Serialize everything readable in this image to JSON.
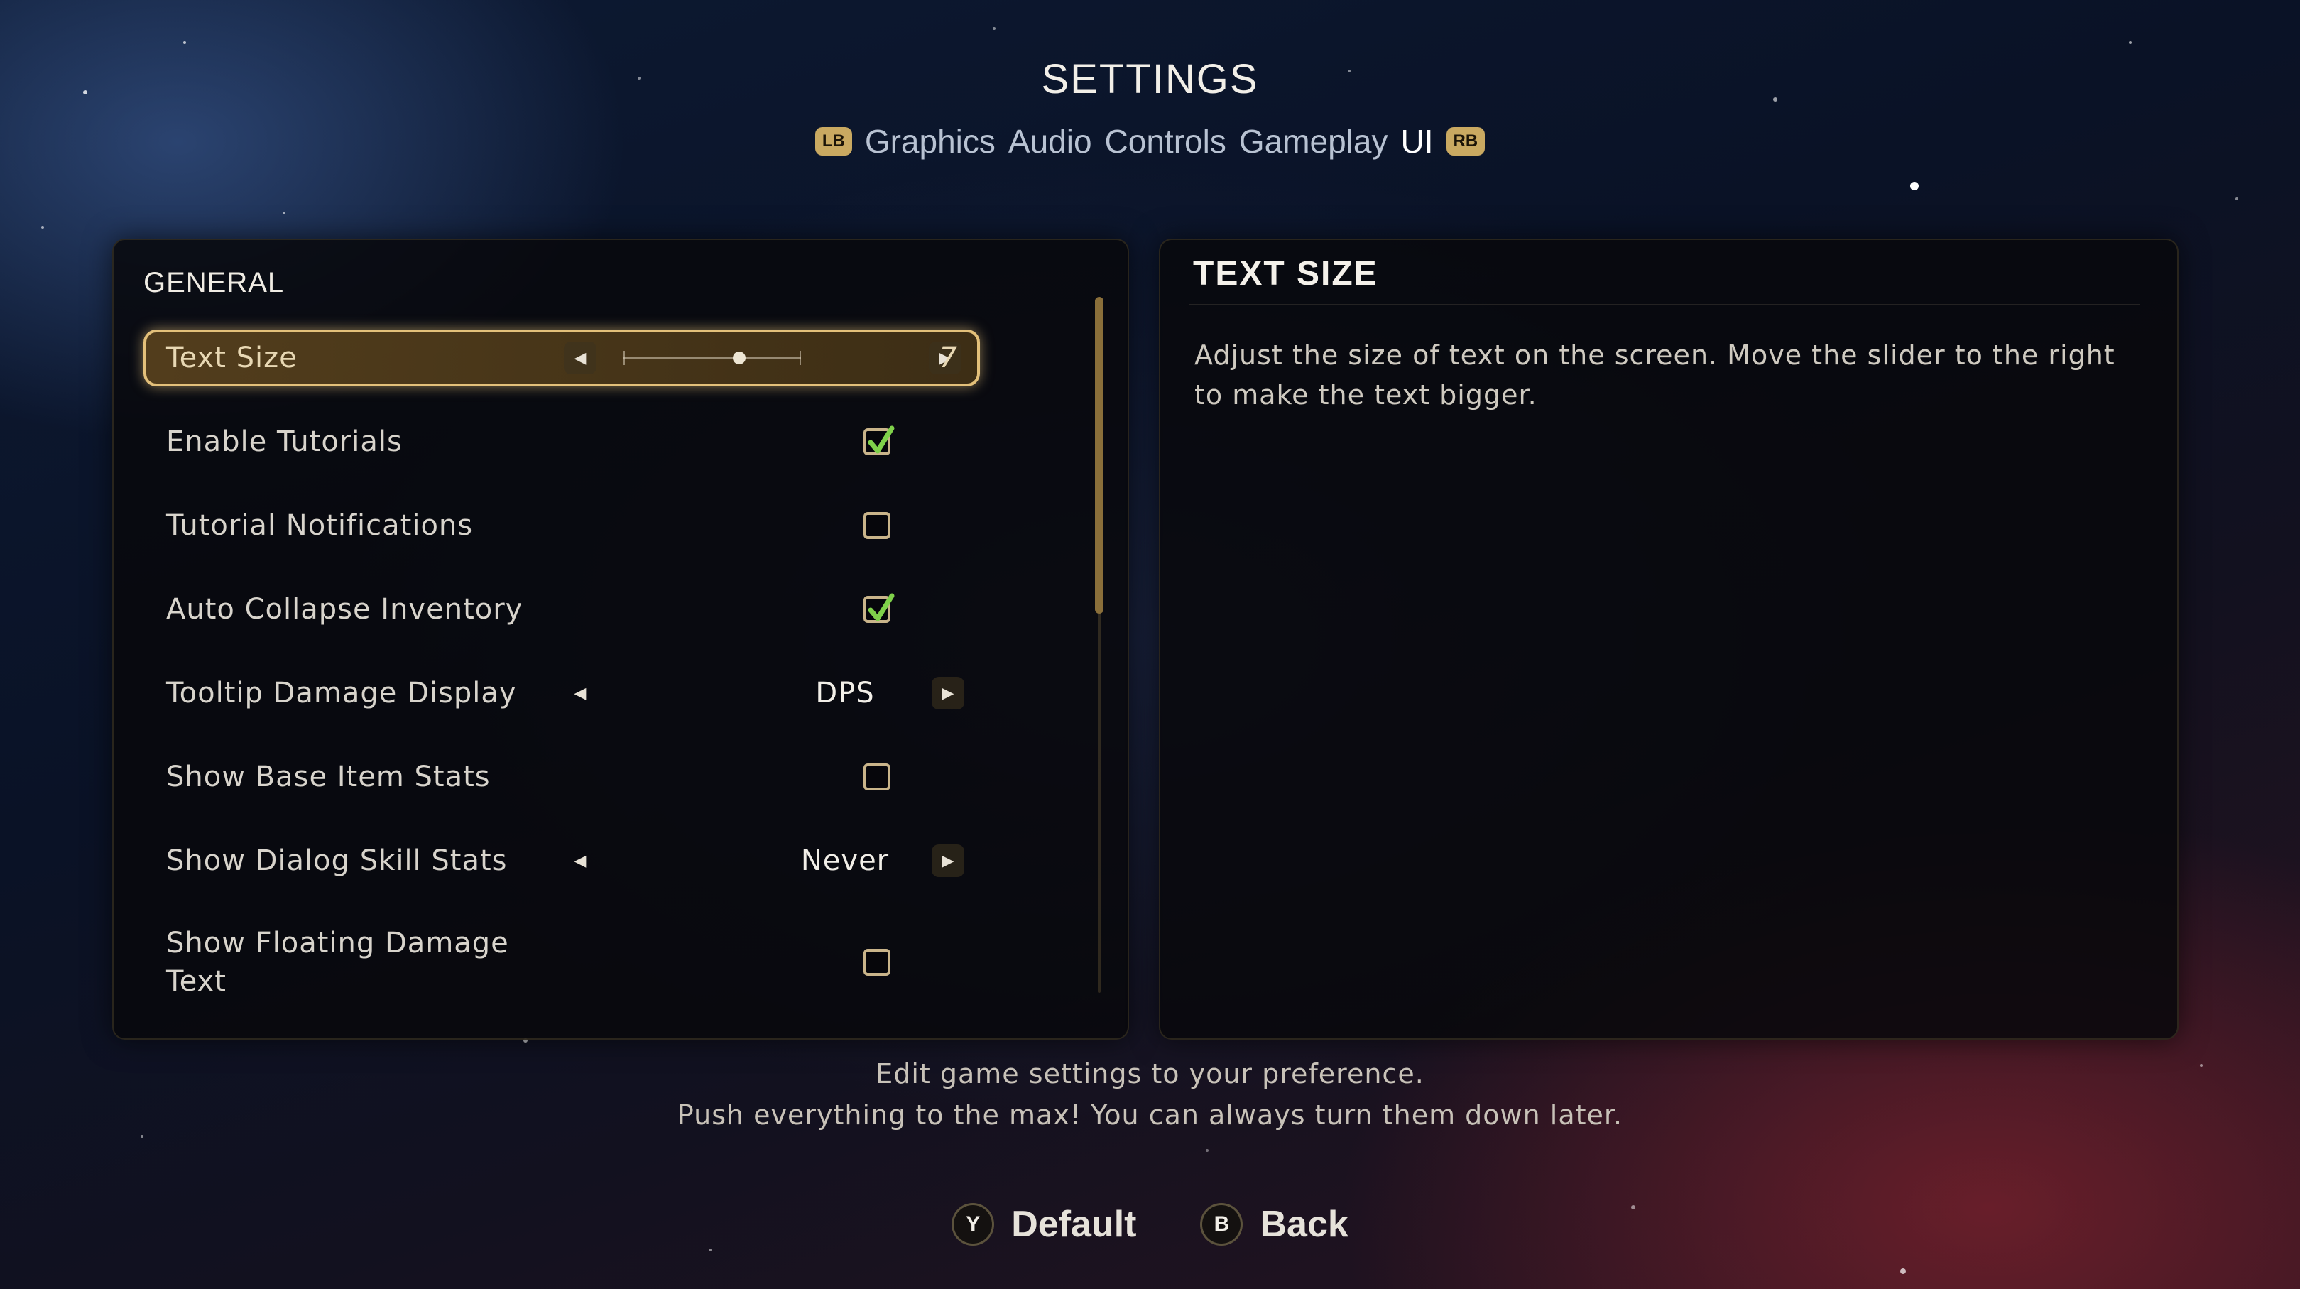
{
  "header": {
    "title": "SETTINGS",
    "left_bumper": "LB",
    "right_bumper": "RB",
    "tabs": [
      {
        "label": "Graphics",
        "active": false
      },
      {
        "label": "Audio",
        "active": false
      },
      {
        "label": "Controls",
        "active": false
      },
      {
        "label": "Gameplay",
        "active": false
      },
      {
        "label": "UI",
        "active": true
      }
    ]
  },
  "left_panel": {
    "section_title": "GENERAL",
    "settings": [
      {
        "label": "Text Size",
        "type": "slider",
        "value": "7",
        "slider_fraction": 0.65,
        "selected": true
      },
      {
        "label": "Enable Tutorials",
        "type": "checkbox",
        "checked": true
      },
      {
        "label": "Tutorial Notifications",
        "type": "checkbox",
        "checked": false
      },
      {
        "label": "Auto Collapse Inventory",
        "type": "checkbox",
        "checked": true
      },
      {
        "label": "Tooltip Damage Display",
        "type": "option",
        "value": "DPS"
      },
      {
        "label": "Show Base Item Stats",
        "type": "checkbox",
        "checked": false
      },
      {
        "label": "Show Dialog Skill Stats",
        "type": "option",
        "value": "Never"
      },
      {
        "label": "Show Floating Damage Text",
        "type": "checkbox",
        "checked": false
      }
    ]
  },
  "right_panel": {
    "title": "TEXT SIZE",
    "description": "Adjust the size of text on the screen. Move the slider to the right to make the text bigger."
  },
  "footer": {
    "line1": "Edit game settings to your preference.",
    "line2": "Push everything to the max! You can always turn them down later."
  },
  "actions": [
    {
      "button": "Y",
      "label": "Default"
    },
    {
      "button": "B",
      "label": "Back"
    }
  ],
  "colors": {
    "accent_gold": "#e3c07a",
    "checkmark_green": "#7fd14a",
    "panel_bg": "#08080c"
  }
}
